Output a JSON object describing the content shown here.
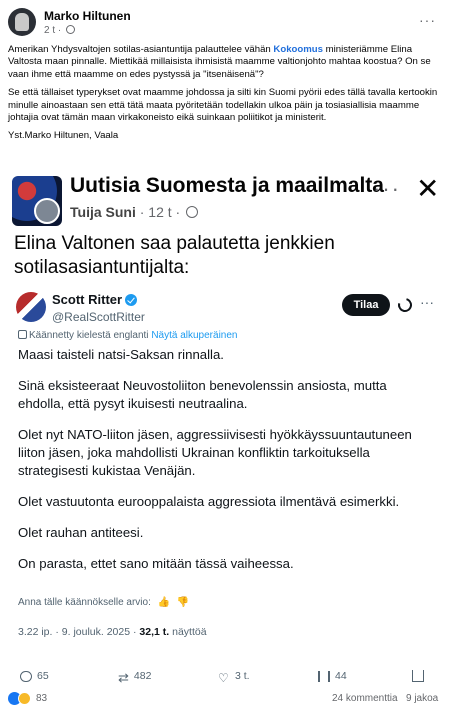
{
  "post": {
    "author": "Marko Hiltunen",
    "time": "2 t",
    "more": "···",
    "paragraph1_pre": "Amerikan Yhdysvaltojen sotilas-asiantuntija palauttelee vähän ",
    "paragraph1_link": "Kokoomus",
    "paragraph1_post": " ministeriämme Elina Valtosta maan pinnalle. Miettikää millaisista ihmisistä maamme valtionjohto mahtaa koostua? On se vaan ihme että maamme on edes pystyssä ja \"itsenäisenä\"?",
    "paragraph2": "Se että tällaiset typerykset ovat maamme johdossa ja silti kin Suomi pyörii edes tällä tavalla kertookin minulle ainoastaan sen että tätä maata pyöritetään todellakin ulkoa päin ja tosiasiallisia maamme johtajia ovat tämän maan virkakoneisto eikä suinkaan poliitikot ja ministerit.",
    "signature": "Yst.Marko Hiltunen, Vaala"
  },
  "embed": {
    "page_title": "Uutisia Suomesta ja maailmalta",
    "page_author": "Tuija Suni",
    "page_time": "· 12 t ·",
    "more": "···",
    "close": "✕",
    "text": "Elina Valtonen saa palautetta jenkkien sotilasasiantuntijalta:"
  },
  "tweet": {
    "name": "Scott Ritter",
    "handle": "@RealScottRitter",
    "follow_label": "Tilaa",
    "more": "···",
    "translate_note": "Käännetty kielestä englanti",
    "translate_link": "Näytä alkuperäinen",
    "paragraphs": [
      "Maasi taisteli natsi-Saksan rinnalla.",
      "Sinä eksisteeraat Neuvostoliiton benevolenssin ansiosta, mutta ehdolla, että pysyt ikuisesti neutraalina.",
      "Olet nyt NATO-liiton jäsen, aggressiivisesti hyökkäyssuuntautuneen liiton jäsen, joka mahdollisti Ukrainan konfliktin tarkoituksella strategisesti kukistaa Venäjän.",
      "Olet vastuutonta eurooppalaista aggressiota ilmentävä esimerkki.",
      "Olet rauhan antiteesi.",
      "On parasta, ettet sano mitään tässä vaiheessa."
    ],
    "rate_label": "Anna tälle käännökselle arvio:",
    "thumb_up": "👍",
    "thumb_down": "👎",
    "date": "3.22 ip. · 9. jouluk. 2025 · ",
    "views_count": "32,1 t.",
    "views_label": " näyttöä",
    "replies": "65",
    "retweets": "482",
    "likes": "3 t.",
    "bookmarks": "44"
  },
  "footer": {
    "reaction_count": "83",
    "comments": "24 kommenttia",
    "shares": "9 jakoa"
  }
}
